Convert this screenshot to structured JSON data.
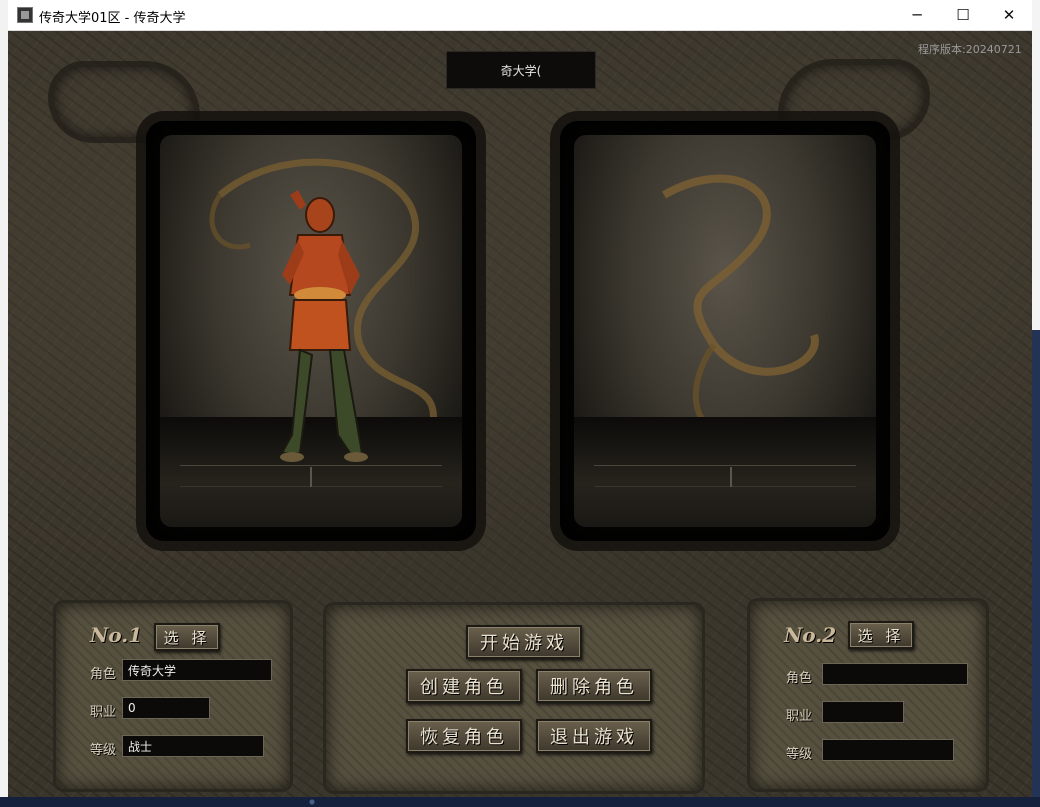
{
  "window": {
    "title": "传奇大学01区 - 传奇大学",
    "min_glyph": "─",
    "max_glyph": "☐",
    "close_glyph": "✕"
  },
  "game": {
    "version": "程序版本:20240721",
    "server_name": "奇大学("
  },
  "slot1": {
    "no": "No.1",
    "select_label": "选 择",
    "role_label": "角色",
    "role_value": "传奇大学",
    "job_label": "职业",
    "job_value": "0",
    "level_label": "等级",
    "level_value": "战士"
  },
  "slot2": {
    "no": "No.2",
    "select_label": "选 择",
    "role_label": "角色",
    "role_value": "",
    "job_label": "职业",
    "job_value": "",
    "level_label": "等级",
    "level_value": ""
  },
  "actions": {
    "start": "开始游戏",
    "create": "创建角色",
    "delete": "删除角色",
    "restore": "恢复角色",
    "exit": "退出游戏"
  },
  "colors": {
    "stone": "#3a352b",
    "button_text": "#eae2cf",
    "label_text": "#d8d0bc"
  }
}
